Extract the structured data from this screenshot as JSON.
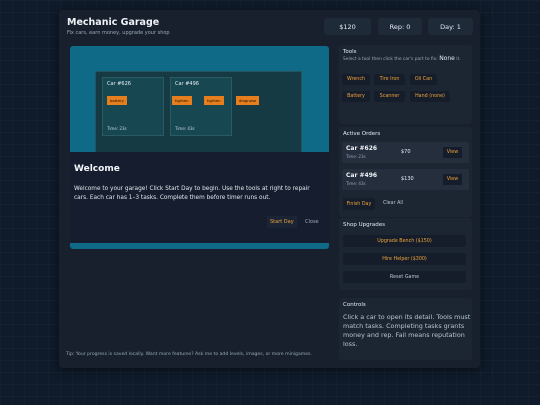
{
  "header": {
    "title": "Mechanic Garage",
    "subtitle": "Fix cars, earn money, upgrade your shop",
    "money": "$120",
    "rep_label": "Rep:",
    "rep_value": "0",
    "day_label": "Day:",
    "day_value": "1"
  },
  "garage": {
    "cars": [
      {
        "name": "Car #626",
        "tasks": [
          "battery"
        ],
        "time": "Time: 23s"
      },
      {
        "name": "Car #496",
        "tasks": [
          "tighten",
          "tighten",
          "diagnose"
        ],
        "time": "Time: 43s"
      }
    ]
  },
  "modal": {
    "title": "Welcome",
    "text": "Welcome to your garage! Click Start Day to begin. Use the tools at right to repair cars. Each car has 1–3 tasks. Complete them before timer runs out.",
    "start_label": "Start Day",
    "close_label": "Close"
  },
  "tools": {
    "title": "Tools",
    "hint_prefix": "Select a tool then click the car's part to fix:",
    "selected": "None",
    "hint_suffix": "it.",
    "buttons": [
      "Wrench",
      "Tire Iron",
      "Oil Can",
      "Battery",
      "Scanner",
      "Hand (none)"
    ]
  },
  "orders": {
    "title": "Active Orders",
    "items": [
      {
        "car": "Car #626",
        "time": "Time: 23s",
        "pay": "$70",
        "action": "View"
      },
      {
        "car": "Car #496",
        "time": "Time: 43s",
        "pay": "$130",
        "action": "View"
      }
    ],
    "finish_label": "Finish Day",
    "clear_label": "Clear All"
  },
  "upgrades": {
    "title": "Shop Upgrades",
    "bench": "Upgrade Bench ($150)",
    "helper": "Hire Helper ($300)",
    "reset": "Reset Game"
  },
  "controls": {
    "title": "Controls",
    "text": "Click a car to open its detail. Tools must match tasks. Completing tasks grants money and rep. Fail means reputation loss."
  },
  "tip": "Tip: Your progress is saved locally. Want more features? Ask me to add levels, images, or more minigames."
}
